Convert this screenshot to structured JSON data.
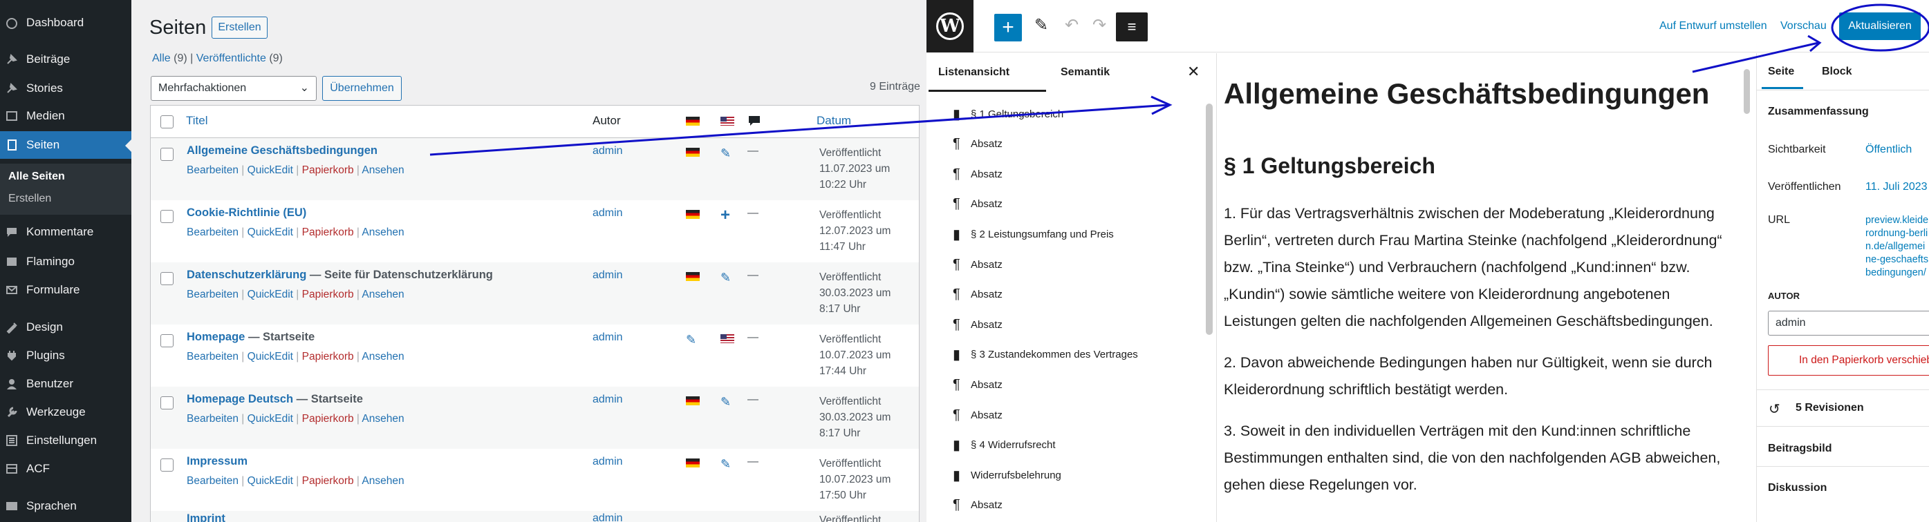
{
  "admin_menu": {
    "items": [
      {
        "label": "Dashboard",
        "icon": "dashboard-icon"
      },
      {
        "label": "Beiträge",
        "icon": "pin-icon"
      },
      {
        "label": "Stories",
        "icon": "pin-icon"
      },
      {
        "label": "Medien",
        "icon": "media-icon"
      },
      {
        "label": "Seiten",
        "icon": "pages-icon"
      },
      {
        "label": "Kommentare",
        "icon": "comments-icon"
      },
      {
        "label": "Flamingo",
        "icon": "flamingo-icon"
      },
      {
        "label": "Formulare",
        "icon": "mail-icon"
      },
      {
        "label": "Design",
        "icon": "brush-icon"
      },
      {
        "label": "Plugins",
        "icon": "plugin-icon"
      },
      {
        "label": "Benutzer",
        "icon": "users-icon"
      },
      {
        "label": "Werkzeuge",
        "icon": "tools-icon"
      },
      {
        "label": "Einstellungen",
        "icon": "settings-icon"
      },
      {
        "label": "ACF",
        "icon": "acf-icon"
      },
      {
        "label": "Sprachen",
        "icon": "languages-icon"
      }
    ],
    "submenu": [
      "Alle Seiten",
      "Erstellen"
    ]
  },
  "pages_list": {
    "title": "Seiten",
    "create_button": "Erstellen",
    "filter_all": "Alle",
    "filter_all_count": "(9)",
    "filter_sep": "|",
    "filter_published": "Veröffentlichte",
    "filter_published_count": "(9)",
    "bulk_actions": "Mehrfachaktionen",
    "apply_button": "Übernehmen",
    "count": "9 Einträge",
    "columns": {
      "title": "Titel",
      "author": "Autor",
      "date": "Datum"
    },
    "row_actions": {
      "edit": "Bearbeiten",
      "quickedit": "QuickEdit",
      "trash": "Papierkorb",
      "view": "Ansehen",
      "sep": "|"
    },
    "rows": [
      {
        "title": "Allgemeine Geschäftsbedingungen",
        "state": "",
        "author": "admin",
        "status": "Veröffentlicht",
        "date": "11.07.2023 um",
        "time": "10:22 Uhr"
      },
      {
        "title": "Cookie-Richtlinie (EU)",
        "state": "",
        "author": "admin",
        "status": "Veröffentlicht",
        "date": "12.07.2023 um",
        "time": "11:47 Uhr"
      },
      {
        "title": "Datenschutzerklärung",
        "state": " — Seite für Datenschutzerklärung",
        "author": "admin",
        "status": "Veröffentlicht",
        "date": "30.03.2023 um",
        "time": "8:17 Uhr"
      },
      {
        "title": "Homepage",
        "state": " — Startseite",
        "author": "admin",
        "status": "Veröffentlicht",
        "date": "10.07.2023 um",
        "time": "17:44 Uhr"
      },
      {
        "title": "Homepage Deutsch",
        "state": " — Startseite",
        "author": "admin",
        "status": "Veröffentlicht",
        "date": "30.03.2023 um",
        "time": "8:17 Uhr"
      },
      {
        "title": "Impressum",
        "state": "",
        "author": "admin",
        "status": "Veröffentlicht",
        "date": "10.07.2023 um",
        "time": "17:50 Uhr"
      },
      {
        "title": "Imprint",
        "state": "",
        "author": "admin",
        "status": "Veröffentlicht",
        "date": "",
        "time": ""
      }
    ],
    "dash": "—"
  },
  "editor": {
    "switch_draft": "Auf Entwurf umstellen",
    "preview": "Vorschau",
    "update": "Aktualisieren",
    "listview": {
      "tab_list": "Listenansicht",
      "tab_outline": "Semantik",
      "items": [
        {
          "label": "§ 1 Geltungsbereich",
          "icon": "bookmark"
        },
        {
          "label": "Absatz",
          "icon": "paragraph"
        },
        {
          "label": "Absatz",
          "icon": "paragraph"
        },
        {
          "label": "Absatz",
          "icon": "paragraph"
        },
        {
          "label": "§ 2 Leistungsumfang und Preis",
          "icon": "bookmark"
        },
        {
          "label": "Absatz",
          "icon": "paragraph"
        },
        {
          "label": "Absatz",
          "icon": "paragraph"
        },
        {
          "label": "Absatz",
          "icon": "paragraph"
        },
        {
          "label": "§ 3 Zustandekommen des Vertrages",
          "icon": "bookmark"
        },
        {
          "label": "Absatz",
          "icon": "paragraph"
        },
        {
          "label": "Absatz",
          "icon": "paragraph"
        },
        {
          "label": "§ 4 Widerrufsrecht",
          "icon": "bookmark"
        },
        {
          "label": "Widerrufsbelehrung",
          "icon": "bookmark"
        },
        {
          "label": "Absatz",
          "icon": "paragraph"
        }
      ]
    },
    "document": {
      "title": "Allgemeine Geschäftsbedingungen",
      "heading": "§ 1 Geltungsbereich",
      "p1": "1. Für das Vertragsverhältnis zwischen der Modeberatung „Kleiderordnung Berlin“, vertreten durch Frau Martina Steinke (nachfolgend „Kleiderordnung“ bzw. „Tina Steinke“) und Verbrauchern (nachfolgend „Kund:innen“ bzw. „Kundin“) sowie sämtliche weitere von Kleiderordnung angebotenen Leistungen gelten die nachfolgenden Allgemeinen Geschäftsbedingungen.",
      "p2": "2. Davon abweichende Bedingungen haben nur Gültigkeit, wenn sie durch Kleiderordnung schriftlich bestätigt werden.",
      "p3": "3. Soweit in den individuellen Verträgen mit den Kund:innen schriftliche Bestimmungen enthalten sind, die von den nachfolgenden AGB abweichen, gehen diese Regelungen vor."
    },
    "sidebar": {
      "tab_page": "Seite",
      "tab_block": "Block",
      "summary": "Zusammenfassung",
      "visibility_label": "Sichtbarkeit",
      "visibility_value": "Öffentlich",
      "publish_label": "Veröffentlichen",
      "publish_value": "11. Juli 2023",
      "url_label": "URL",
      "url_value": "preview.kleiderordnung-berlin.de/allgemeine-geschaeftsbedingungen/",
      "author_label": "AUTOR",
      "author_value": "admin",
      "trash": "In den Papierkorb verschieben",
      "revisions": "5 Revisionen",
      "featured_image": "Beitragsbild",
      "discussion": "Diskussion"
    }
  },
  "colors": {
    "admin_bg": "#1d2327",
    "accent": "#2271b1",
    "editor_accent": "#007cba",
    "annotation": "#1010c8"
  }
}
